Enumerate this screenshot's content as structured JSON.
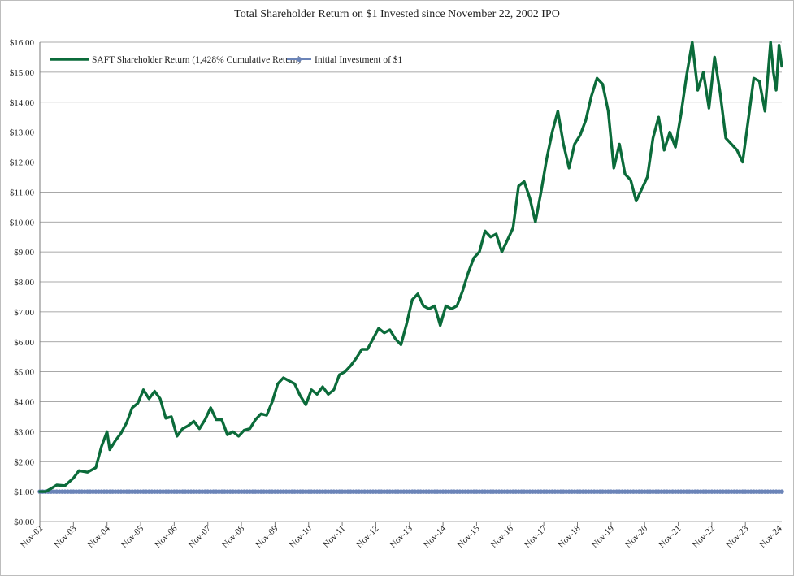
{
  "chart_data": {
    "type": "line",
    "title": "Total Shareholder Return on $1 Invested since November 22, 2002 IPO",
    "xlabel": "",
    "ylabel": "",
    "ylim": [
      0,
      16
    ],
    "y_ticks": [
      "$0.00",
      "$1.00",
      "$2.00",
      "$3.00",
      "$4.00",
      "$5.00",
      "$6.00",
      "$7.00",
      "$8.00",
      "$9.00",
      "$10.00",
      "$11.00",
      "$12.00",
      "$13.00",
      "$14.00",
      "$15.00",
      "$16.00"
    ],
    "x_ticks": [
      "Nov-02",
      "Nov-03",
      "Nov-04",
      "Nov-05",
      "Nov-06",
      "Nov-07",
      "Nov-08",
      "Nov-09",
      "Nov-10",
      "Nov-11",
      "Nov-12",
      "Nov-13",
      "Nov-14",
      "Nov-15",
      "Nov-16",
      "Nov-17",
      "Nov-18",
      "Nov-19",
      "Nov-20",
      "Nov-21",
      "Nov-22",
      "Nov-23",
      "Nov-24"
    ],
    "grid": "horizontal",
    "legend_position": "top-left",
    "series": [
      {
        "name": "SAFT Shareholder Return (1,428% Cumulative Return)",
        "color": "#0b6b3a",
        "style": "thick-line",
        "points": [
          [
            "Nov-02",
            1.0
          ],
          [
            "Jan-03",
            1.0
          ],
          [
            "Mar-03",
            1.1
          ],
          [
            "May-03",
            1.22
          ],
          [
            "Aug-03",
            1.2
          ],
          [
            "Nov-03",
            1.45
          ],
          [
            "Jan-04",
            1.7
          ],
          [
            "Apr-04",
            1.65
          ],
          [
            "Jul-04",
            1.8
          ],
          [
            "Sep-04",
            2.5
          ],
          [
            "Nov-04",
            3.0
          ],
          [
            "Dec-04",
            2.4
          ],
          [
            "Feb-05",
            2.7
          ],
          [
            "Apr-05",
            2.95
          ],
          [
            "Jun-05",
            3.3
          ],
          [
            "Aug-05",
            3.8
          ],
          [
            "Oct-05",
            3.95
          ],
          [
            "Dec-05",
            4.4
          ],
          [
            "Feb-06",
            4.1
          ],
          [
            "Apr-06",
            4.35
          ],
          [
            "Jun-06",
            4.1
          ],
          [
            "Aug-06",
            3.45
          ],
          [
            "Oct-06",
            3.5
          ],
          [
            "Dec-06",
            2.85
          ],
          [
            "Feb-07",
            3.1
          ],
          [
            "Apr-07",
            3.2
          ],
          [
            "Jun-07",
            3.35
          ],
          [
            "Aug-07",
            3.1
          ],
          [
            "Oct-07",
            3.4
          ],
          [
            "Dec-07",
            3.8
          ],
          [
            "Feb-08",
            3.4
          ],
          [
            "Apr-08",
            3.4
          ],
          [
            "Jun-08",
            2.9
          ],
          [
            "Aug-08",
            3.0
          ],
          [
            "Oct-08",
            2.85
          ],
          [
            "Dec-08",
            3.05
          ],
          [
            "Feb-09",
            3.1
          ],
          [
            "Apr-09",
            3.4
          ],
          [
            "Jun-09",
            3.6
          ],
          [
            "Aug-09",
            3.55
          ],
          [
            "Oct-09",
            4.0
          ],
          [
            "Dec-09",
            4.6
          ],
          [
            "Feb-10",
            4.8
          ],
          [
            "Apr-10",
            4.7
          ],
          [
            "Jun-10",
            4.6
          ],
          [
            "Aug-10",
            4.2
          ],
          [
            "Oct-10",
            3.9
          ],
          [
            "Dec-10",
            4.4
          ],
          [
            "Feb-11",
            4.25
          ],
          [
            "Apr-11",
            4.5
          ],
          [
            "Jun-11",
            4.25
          ],
          [
            "Aug-11",
            4.4
          ],
          [
            "Oct-11",
            4.9
          ],
          [
            "Dec-11",
            5.0
          ],
          [
            "Feb-12",
            5.2
          ],
          [
            "Apr-12",
            5.45
          ],
          [
            "Jun-12",
            5.75
          ],
          [
            "Aug-12",
            5.75
          ],
          [
            "Oct-12",
            6.1
          ],
          [
            "Dec-12",
            6.45
          ],
          [
            "Feb-13",
            6.3
          ],
          [
            "Apr-13",
            6.4
          ],
          [
            "Jun-13",
            6.1
          ],
          [
            "Aug-13",
            5.9
          ],
          [
            "Oct-13",
            6.6
          ],
          [
            "Dec-13",
            7.4
          ],
          [
            "Feb-14",
            7.6
          ],
          [
            "Apr-14",
            7.2
          ],
          [
            "Jun-14",
            7.1
          ],
          [
            "Aug-14",
            7.2
          ],
          [
            "Oct-14",
            6.55
          ],
          [
            "Dec-14",
            7.2
          ],
          [
            "Feb-15",
            7.1
          ],
          [
            "Apr-15",
            7.2
          ],
          [
            "Jun-15",
            7.7
          ],
          [
            "Aug-15",
            8.3
          ],
          [
            "Oct-15",
            8.8
          ],
          [
            "Dec-15",
            9.0
          ],
          [
            "Feb-16",
            9.7
          ],
          [
            "Apr-16",
            9.5
          ],
          [
            "Jun-16",
            9.6
          ],
          [
            "Aug-16",
            9.0
          ],
          [
            "Oct-16",
            9.4
          ],
          [
            "Dec-16",
            9.8
          ],
          [
            "Feb-17",
            11.2
          ],
          [
            "Apr-17",
            11.35
          ],
          [
            "Jun-17",
            10.8
          ],
          [
            "Aug-17",
            10.0
          ],
          [
            "Oct-17",
            11.0
          ],
          [
            "Dec-17",
            12.1
          ],
          [
            "Feb-18",
            13.0
          ],
          [
            "Apr-18",
            13.7
          ],
          [
            "Jun-18",
            12.6
          ],
          [
            "Aug-18",
            11.8
          ],
          [
            "Oct-18",
            12.6
          ],
          [
            "Dec-18",
            12.9
          ],
          [
            "Feb-19",
            13.4
          ],
          [
            "Apr-19",
            14.2
          ],
          [
            "Jun-19",
            14.8
          ],
          [
            "Aug-19",
            14.6
          ],
          [
            "Oct-19",
            13.7
          ],
          [
            "Dec-19",
            11.8
          ],
          [
            "Feb-20",
            12.6
          ],
          [
            "Apr-20",
            11.6
          ],
          [
            "Jun-20",
            11.4
          ],
          [
            "Aug-20",
            10.7
          ],
          [
            "Oct-20",
            11.1
          ],
          [
            "Dec-20",
            11.5
          ],
          [
            "Feb-21",
            12.8
          ],
          [
            "Apr-21",
            13.5
          ],
          [
            "Jun-21",
            12.4
          ],
          [
            "Aug-21",
            13.0
          ],
          [
            "Oct-21",
            12.5
          ],
          [
            "Dec-21",
            13.6
          ],
          [
            "Feb-22",
            14.9
          ],
          [
            "Apr-22",
            16.0
          ],
          [
            "Jun-22",
            14.4
          ],
          [
            "Aug-22",
            15.0
          ],
          [
            "Oct-22",
            13.8
          ],
          [
            "Dec-22",
            15.5
          ],
          [
            "Feb-23",
            14.3
          ],
          [
            "Apr-23",
            12.8
          ],
          [
            "Jun-23",
            12.6
          ],
          [
            "Aug-23",
            12.4
          ],
          [
            "Oct-23",
            12.0
          ],
          [
            "Dec-23",
            13.4
          ],
          [
            "Feb-24",
            14.8
          ],
          [
            "Apr-24",
            14.7
          ],
          [
            "Jun-24",
            13.7
          ],
          [
            "Aug-24",
            16.0
          ],
          [
            "Sep-24",
            15.0
          ],
          [
            "Oct-24",
            14.4
          ],
          [
            "Nov-24",
            15.9
          ],
          [
            "Dec-24",
            15.2
          ]
        ]
      },
      {
        "name": "Initial Investment of $1",
        "color": "#6b84b8",
        "style": "line-with-markers",
        "constant_value": 1.0
      }
    ]
  }
}
